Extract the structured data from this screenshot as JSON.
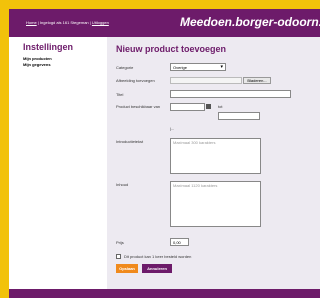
{
  "header": {
    "breadcrumb": {
      "home": "Home",
      "sep1": " | ",
      "middle": "Ingelogd als 161 Stegeman",
      "sep2": " | ",
      "logout": "Uitloggen"
    },
    "site_title": "Meedoen.borger-odoorn."
  },
  "sidebar": {
    "title": "Instellingen",
    "items": [
      {
        "label": "Mijn producten"
      },
      {
        "label": "Mijn gegevens"
      }
    ]
  },
  "form": {
    "title": "Nieuw product toevoegen",
    "category_label": "Categorie",
    "category_value": "Overige",
    "image_label": "Afbeelding toevoegen",
    "browse_label": "Bladeren...",
    "title_label": "Titel",
    "available_label": "Product beschikbaar van",
    "until_label": "tot",
    "dash": "|...",
    "intro_label": "Introductietekst",
    "intro_placeholder": "Maximaal 300 karakters",
    "content_label": "Inhoud",
    "content_placeholder": "Maximaal 1120 karakters",
    "price_label": "Prijs",
    "price_value": "0,00",
    "checkbox_label": "Dit product kan 1 keer besteld worden",
    "save_label": "Opslaan",
    "cancel_label": "Annuleren"
  },
  "colors": {
    "brand": "#6d1b6a",
    "accent": "#f08a1c",
    "frame": "#f2c20a"
  }
}
